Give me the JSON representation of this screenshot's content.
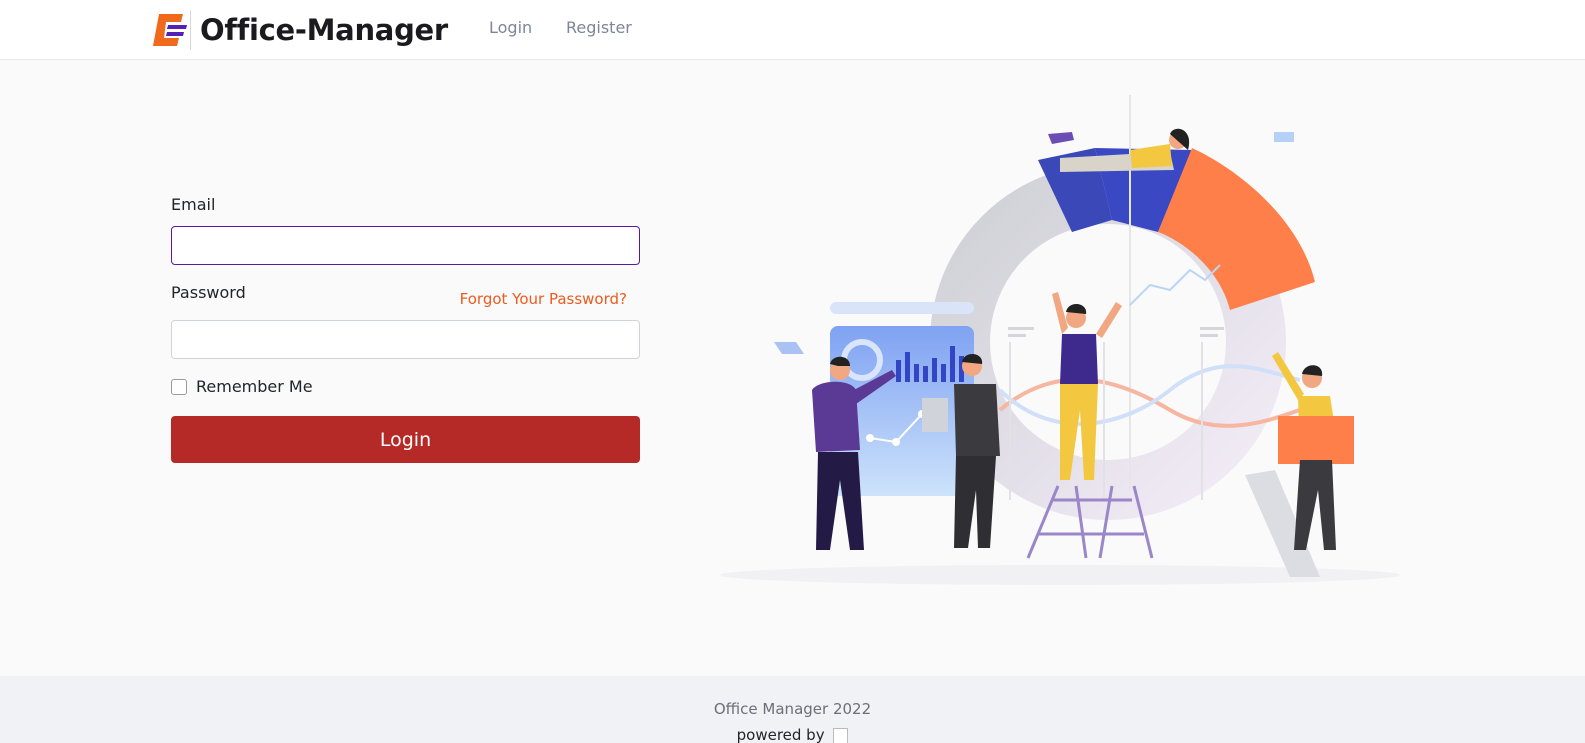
{
  "nav": {
    "brand_name": "Office-Manager",
    "links": [
      {
        "label": "Login"
      },
      {
        "label": "Register"
      }
    ],
    "colors": {
      "logo_primary": "#f06a1d",
      "logo_secondary": "#5222b8"
    }
  },
  "login_form": {
    "email_label": "Email",
    "email_value": "",
    "password_label": "Password",
    "password_value": "",
    "forgot_password": "Forgot Your Password?",
    "remember_me": "Remember Me",
    "remember_checked": false,
    "submit_label": "Login",
    "colors": {
      "button": "#b52a27",
      "focus_border": "#5a17a8",
      "forgot_link": "#ec5b1f"
    }
  },
  "illustration": {
    "icon": "team-analytics-illustration"
  },
  "footer": {
    "copyright": "Office Manager 2022",
    "powered_by": "powered by",
    "powered_by_icon": "broken-image-icon"
  }
}
